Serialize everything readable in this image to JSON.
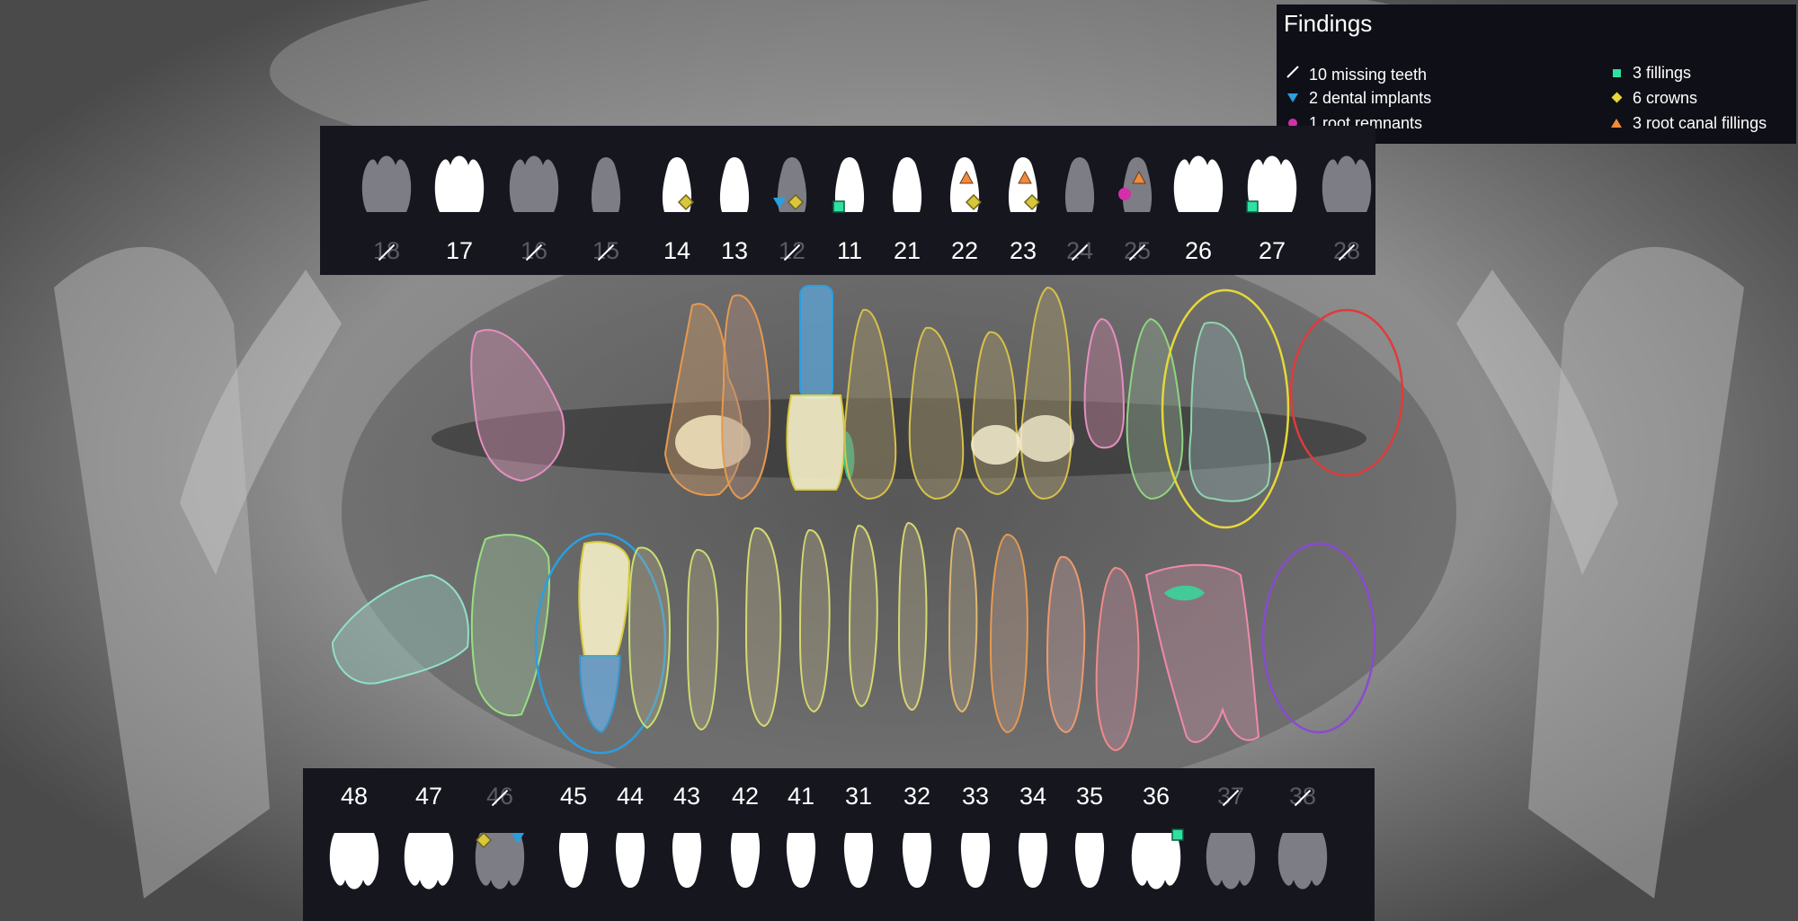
{
  "findings": {
    "title": "Findings",
    "items": [
      {
        "label": "10 missing teeth",
        "icon": "missing-tooth-slash-icon",
        "color": "#ffffff"
      },
      {
        "label": "2 dental implants",
        "icon": "implant-triangle-icon",
        "color": "#2a9fe0"
      },
      {
        "label": "1 root remnants",
        "icon": "root-remnant-dot-icon",
        "color": "#d22fa8"
      },
      {
        "label": "3 fillings",
        "icon": "filling-square-icon",
        "color": "#2fe0a0"
      },
      {
        "label": "6 crowns",
        "icon": "crown-diamond-icon",
        "color": "#e6d838"
      },
      {
        "label": "3 root canal fillings",
        "icon": "root-canal-triangle-icon",
        "color": "#f08a3c"
      }
    ]
  },
  "colors": {
    "present_tooth": "#ffffff",
    "missing_tooth": "#7d7d85",
    "implant": "#2a9fe0",
    "filling": "#2fe0a0",
    "crown": "#d9c63a",
    "root_canal": "#f08a3c",
    "root_remnant": "#d22fa8"
  },
  "upper_teeth": [
    {
      "number": "18",
      "missing": true,
      "shape": "molar",
      "marks": []
    },
    {
      "number": "17",
      "missing": false,
      "shape": "molar",
      "marks": []
    },
    {
      "number": "16",
      "missing": true,
      "shape": "molar",
      "marks": []
    },
    {
      "number": "15",
      "missing": true,
      "shape": "single",
      "marks": []
    },
    {
      "number": "14",
      "missing": false,
      "shape": "single",
      "marks": [
        "crown"
      ]
    },
    {
      "number": "13",
      "missing": false,
      "shape": "single",
      "marks": []
    },
    {
      "number": "12",
      "missing": true,
      "shape": "single",
      "marks": [
        "implant",
        "crown"
      ]
    },
    {
      "number": "11",
      "missing": false,
      "shape": "single",
      "marks": [
        "filling"
      ]
    },
    {
      "number": "21",
      "missing": false,
      "shape": "single",
      "marks": []
    },
    {
      "number": "22",
      "missing": false,
      "shape": "single",
      "marks": [
        "root_canal",
        "crown"
      ]
    },
    {
      "number": "23",
      "missing": false,
      "shape": "single",
      "marks": [
        "root_canal",
        "crown"
      ]
    },
    {
      "number": "24",
      "missing": true,
      "shape": "single",
      "marks": []
    },
    {
      "number": "25",
      "missing": true,
      "shape": "single",
      "marks": [
        "root_canal",
        "root_remnant"
      ]
    },
    {
      "number": "26",
      "missing": false,
      "shape": "molar",
      "marks": []
    },
    {
      "number": "27",
      "missing": false,
      "shape": "molar",
      "marks": [
        "filling"
      ]
    },
    {
      "number": "28",
      "missing": true,
      "shape": "molar",
      "marks": []
    }
  ],
  "lower_teeth": [
    {
      "number": "48",
      "missing": false,
      "shape": "molar",
      "marks": []
    },
    {
      "number": "47",
      "missing": false,
      "shape": "molar",
      "marks": []
    },
    {
      "number": "46",
      "missing": true,
      "shape": "molar",
      "marks": [
        "crown",
        "implant"
      ]
    },
    {
      "number": "45",
      "missing": false,
      "shape": "single",
      "marks": []
    },
    {
      "number": "44",
      "missing": false,
      "shape": "single",
      "marks": []
    },
    {
      "number": "43",
      "missing": false,
      "shape": "single",
      "marks": []
    },
    {
      "number": "42",
      "missing": false,
      "shape": "single",
      "marks": []
    },
    {
      "number": "41",
      "missing": false,
      "shape": "single",
      "marks": []
    },
    {
      "number": "31",
      "missing": false,
      "shape": "single",
      "marks": []
    },
    {
      "number": "32",
      "missing": false,
      "shape": "single",
      "marks": []
    },
    {
      "number": "33",
      "missing": false,
      "shape": "single",
      "marks": []
    },
    {
      "number": "34",
      "missing": false,
      "shape": "single",
      "marks": []
    },
    {
      "number": "35",
      "missing": false,
      "shape": "single",
      "marks": []
    },
    {
      "number": "36",
      "missing": false,
      "shape": "molar",
      "marks": [
        "filling"
      ]
    },
    {
      "number": "37",
      "missing": true,
      "shape": "molar",
      "marks": []
    },
    {
      "number": "38",
      "missing": true,
      "shape": "molar",
      "marks": []
    }
  ]
}
